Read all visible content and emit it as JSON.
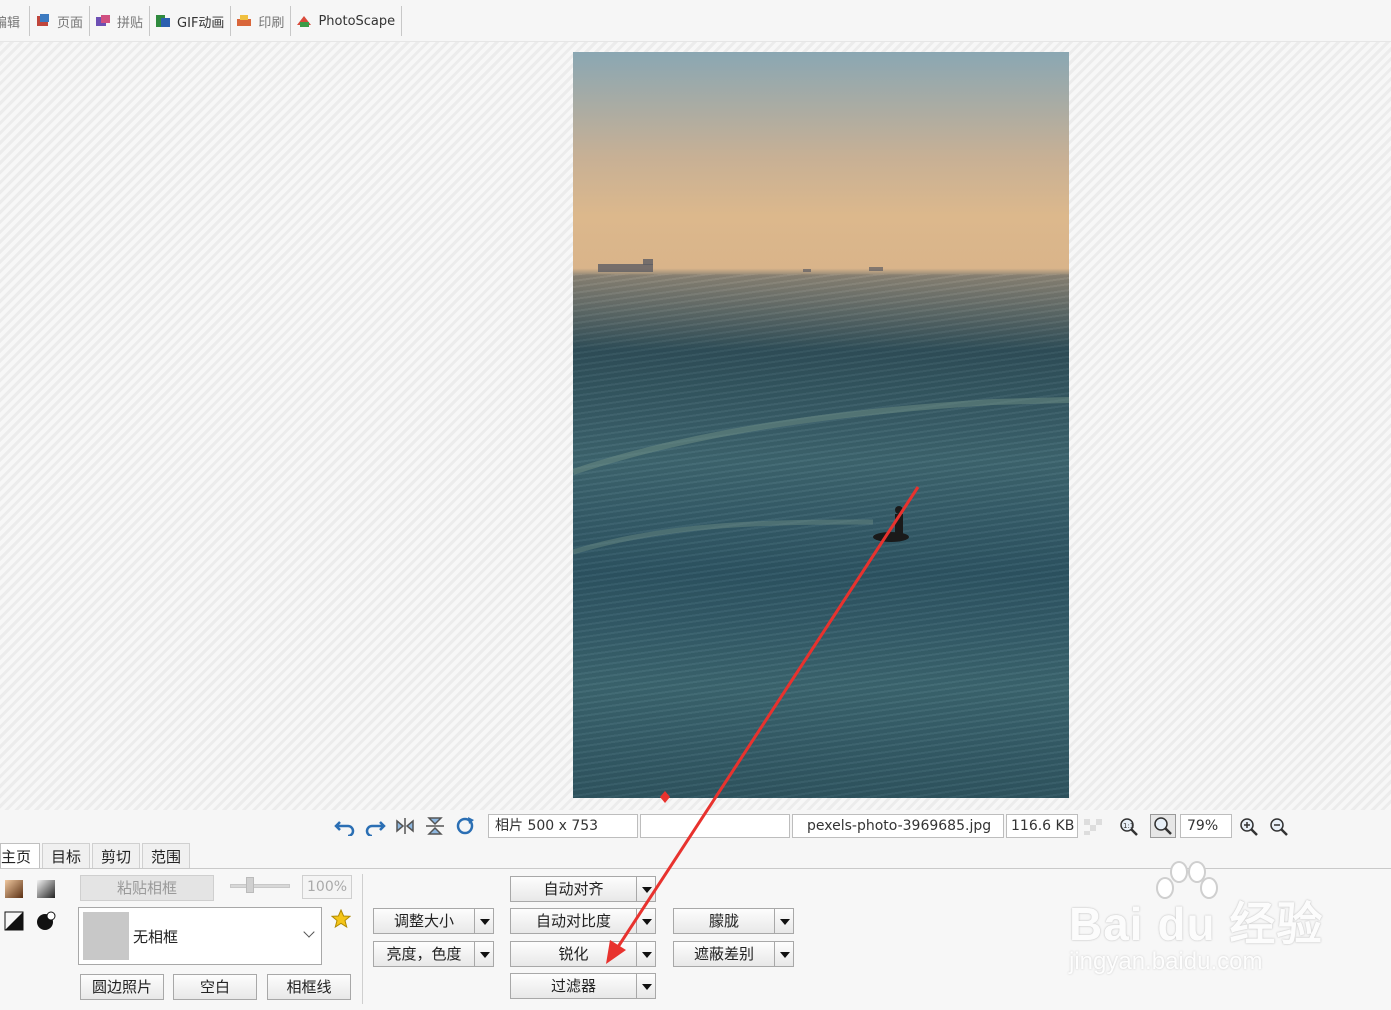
{
  "tabs": [
    {
      "label": "编辑"
    },
    {
      "label": "页面"
    },
    {
      "label": "拼贴"
    },
    {
      "label": "GIF动画"
    },
    {
      "label": "印刷"
    },
    {
      "label": "PhotoScape"
    }
  ],
  "status": {
    "photo_size": "相片 500 x 753",
    "file_name": "pexels-photo-3969685.jpg",
    "file_size": "116.6 KB",
    "zoom": "79%"
  },
  "panel_tabs": [
    "主页",
    "目标",
    "剪切",
    "范围"
  ],
  "frame": {
    "paste_button": "粘贴相框",
    "opacity": "100%",
    "selected": "无相框",
    "round_button": "圆边照片",
    "blank_button": "空白",
    "frame_line_button": "相框线"
  },
  "tools": {
    "resize": "调整大小",
    "brightness": "亮度，色度",
    "auto_level": "自动对齐",
    "auto_contrast": "自动对比度",
    "sharpen": "锐化",
    "filter": "过滤器",
    "blur": "朦胧",
    "mask": "遮蔽差别"
  },
  "watermark": {
    "brand": "Bai du 经验",
    "url": "jingyan.baidu.com"
  },
  "colors": {
    "annotation_arrow": "#e8322e"
  }
}
